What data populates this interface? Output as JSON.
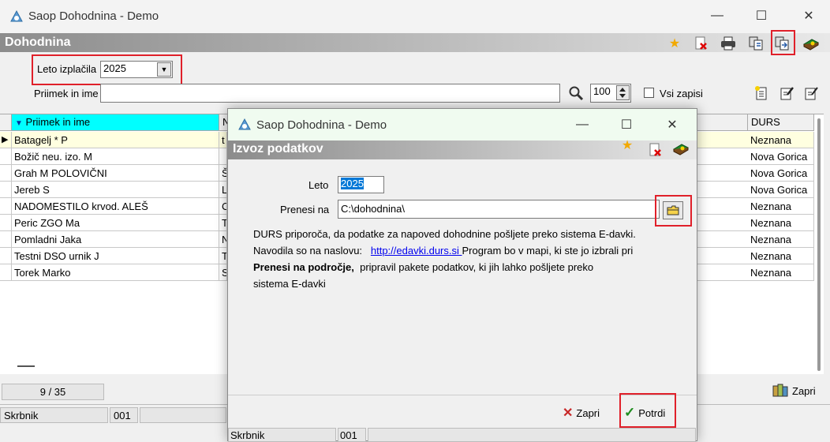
{
  "main": {
    "title": "Saop Dohodnina - Demo",
    "window_controls": {
      "minimize": "—",
      "maximize": "☐",
      "close": "✕"
    },
    "section_title": "Dohodnina",
    "toolbar_icons": [
      "star-icon",
      "delete-icon",
      "print-icon",
      "copy-icon",
      "export-icon",
      "book-icon"
    ],
    "year_label": "Leto izplačila",
    "year_value": "2025",
    "name_label": "Priimek in ime",
    "name_value": "",
    "page_size": "100",
    "all_records_label": "Vsi zapisi",
    "grid": {
      "columns": [
        "Priimek in ime",
        "N",
        "DURS"
      ],
      "rows": [
        {
          "name": "Batagelj * P",
          "col2": "t",
          "durs": "Neznana"
        },
        {
          "name": "Božič neu. izo. M",
          "col2": "",
          "durs": "Nova Gorica"
        },
        {
          "name": "Grah M POLOVIČNI",
          "col2": "Š",
          "durs": "Nova Gorica"
        },
        {
          "name": "Jereb S",
          "col2": "L",
          "durs": "Nova Gorica"
        },
        {
          "name": "NADOMESTILO krvod. ALEŠ",
          "col2": "C",
          "durs": "Neznana"
        },
        {
          "name": "Peric ZGO Ma",
          "col2": "T",
          "durs": "Neznana"
        },
        {
          "name": "Pomladni Jaka",
          "col2": "N",
          "durs": "Neznana"
        },
        {
          "name": "Testni DSO urnik J",
          "col2": "T",
          "durs": "Neznana"
        },
        {
          "name": "Torek Marko",
          "col2": "S",
          "durs": "Neznana"
        }
      ]
    },
    "record_counter": "9 / 35",
    "close_label": "Zapri",
    "status_user": "Skrbnik",
    "status_code": "001"
  },
  "dialog": {
    "title": "Saop Dohodnina - Demo",
    "section_title": "Izvoz podatkov",
    "year_label": "Leto",
    "year_value": "2025",
    "path_label": "Prenesi na",
    "path_value": "C:\\dohodnina\\",
    "info_line1": "DURS priporoča, da podatke za napoved dohodnine pošljete preko sistema E-davki.",
    "info_line2_prefix": "Navodila so na naslovu:",
    "info_link": "http://edavki.durs.si ",
    "info_line2_suffix": "Program bo v mapi, ki ste jo izbrali pri",
    "info_bold": "Prenesi na področje,",
    "info_line3_suffix": "pripravil pakete podatkov, ki jih lahko pošljete preko",
    "info_line4": "sistema E-davki",
    "cancel_label": "Zapri",
    "confirm_label": "Potrdi",
    "status_user": "Skrbnik",
    "status_code": "001"
  },
  "colors": {
    "highlight_red": "#e0202a",
    "sorted_header": "#00ffff",
    "selected_row": "#ffffe0",
    "link": "#0000ee"
  }
}
